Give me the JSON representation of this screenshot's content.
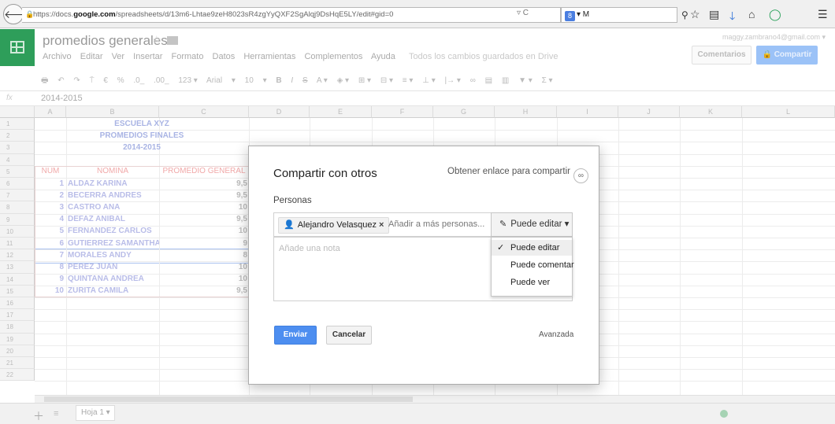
{
  "browser": {
    "url_prefix": "https://docs.",
    "url_domain": "google.com",
    "url_path": "/spreadsheets/d/13m6-Lhtae9zeH8023sR4zgYyQXF2SgAlqj9DsHqE5LY/edit#gid=0",
    "url_actions": "▿ C",
    "search_engine_badge": "8",
    "search_text": "▾ M",
    "icons": [
      "back-icon",
      "lock-icon",
      "search-icon",
      "star-icon",
      "reading-list-icon",
      "download-icon",
      "home-icon",
      "extension-icon",
      "menu-icon"
    ]
  },
  "docs": {
    "title": "promedios generales",
    "account": "maggy.zambrano4@gmail.com ▾",
    "comments_label": "Comentarios",
    "share_label": "🔒 Compartir",
    "menu": [
      "Archivo",
      "Editar",
      "Ver",
      "Insertar",
      "Formato",
      "Datos",
      "Herramientas",
      "Complementos",
      "Ayuda"
    ],
    "saved_status": "Todos los cambios guardados en Drive",
    "toolbar": [
      "🖶",
      "↶",
      "↷",
      "⍑",
      "€",
      "%",
      ".0_",
      ".00_",
      "123 ▾",
      "Arial",
      "▾",
      "10",
      "▾",
      "B",
      "I",
      "S",
      "A ▾",
      "◈ ▾",
      "⊞ ▾",
      "⊟ ▾",
      "≡ ▾",
      "⊥ ▾",
      "|→ ▾",
      "∞",
      "▤",
      "▥",
      "▼ ▾",
      "Σ ▾"
    ],
    "formula_label": "fx",
    "formula_value": "2014-2015"
  },
  "sheet": {
    "columns": [
      "A",
      "B",
      "C",
      "D",
      "E",
      "F",
      "G",
      "H",
      "I",
      "J",
      "K",
      "L"
    ],
    "rows": [
      "1",
      "2",
      "3",
      "4",
      "5",
      "6",
      "7",
      "8",
      "9",
      "10",
      "11",
      "12",
      "13",
      "14",
      "15",
      "16",
      "17",
      "18",
      "19",
      "20",
      "21",
      "22"
    ],
    "title1": "ESCUELA XYZ",
    "title2": "PROMEDIOS FINALES",
    "title3": "2014-2015",
    "headers": [
      "NUM",
      "NOMINA",
      "PROMEDIO GENERAL"
    ],
    "students": [
      {
        "num": "1",
        "name": "ALDAZ KARINA",
        "avg": "9,5"
      },
      {
        "num": "2",
        "name": "BECERRA ANDRES",
        "avg": "9,5"
      },
      {
        "num": "3",
        "name": "CASTRO ANA",
        "avg": "10"
      },
      {
        "num": "4",
        "name": "DEFAZ ANIBAL",
        "avg": "9,5"
      },
      {
        "num": "5",
        "name": "FERNANDEZ CARLOS",
        "avg": "10"
      },
      {
        "num": "6",
        "name": "GUTIERREZ SAMANTHA",
        "avg": "9"
      },
      {
        "num": "7",
        "name": "MORALES ANDY",
        "avg": "8"
      },
      {
        "num": "8",
        "name": "PEREZ JUAN",
        "avg": "10"
      },
      {
        "num": "9",
        "name": "QUINTANA ANDREA",
        "avg": "10"
      },
      {
        "num": "10",
        "name": "ZURITA CAMILA",
        "avg": "9,5"
      }
    ],
    "sheet_tab": "Hoja 1 ▾",
    "scroll_mark": "III"
  },
  "dialog": {
    "title": "Compartir con otros",
    "link_share": "Obtener enlace para compartir",
    "people_label": "Personas",
    "chip_name": "Alejandro Velasquez",
    "chip_remove": "×",
    "add_people_placeholder": "Añadir a más personas...",
    "permission": "Puede editar ▾",
    "note_placeholder": "Añade una nota",
    "menu_items": [
      "Puede editar",
      "Puede comentar",
      "Puede ver"
    ],
    "send_label": "Enviar",
    "cancel_label": "Cancelar",
    "advanced_label": "Avanzada"
  }
}
